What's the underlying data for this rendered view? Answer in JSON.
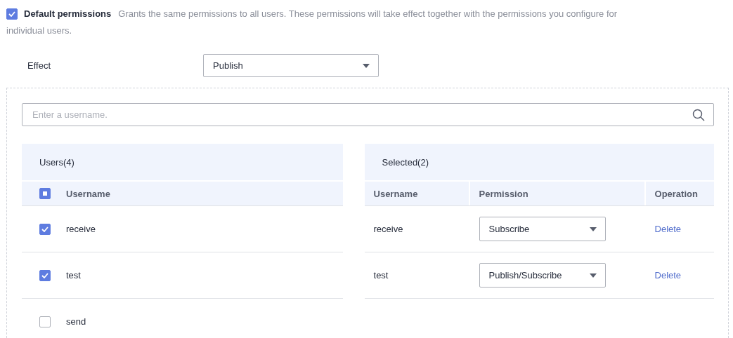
{
  "default_permissions": {
    "checked": true,
    "label": "Default permissions",
    "description_lines": [
      "Grants the same permissions to all users. These permissions will take effect together with the permissions you configure for",
      "individual users."
    ]
  },
  "effect": {
    "label": "Effect",
    "value": "Publish"
  },
  "search": {
    "placeholder": "Enter a username."
  },
  "users_panel": {
    "title": "Users(4)",
    "select_all": {
      "indeterminate": true
    },
    "column": "Username",
    "rows": [
      {
        "name": "receive",
        "checked": true
      },
      {
        "name": "test",
        "checked": true
      },
      {
        "name": "send",
        "checked": false
      }
    ]
  },
  "selected_panel": {
    "title": "Selected(2)",
    "columns": [
      "Username",
      "Permission",
      "Operation"
    ],
    "rows": [
      {
        "name": "receive",
        "permission": "Subscribe",
        "action": "Delete"
      },
      {
        "name": "test",
        "permission": "Publish/Subscribe",
        "action": "Delete"
      }
    ]
  }
}
